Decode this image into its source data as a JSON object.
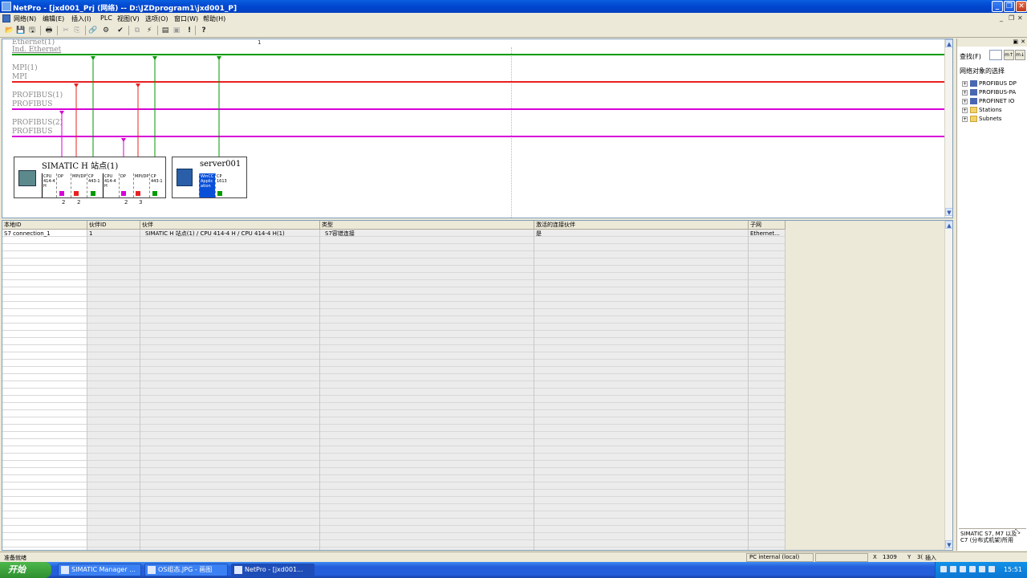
{
  "window": {
    "title": "NetPro - [jxd001_Prj (网络) -- D:\\JZDprogram1\\jxd001_P]",
    "minimize": "_",
    "maximize": "❐",
    "close": "✕"
  },
  "menu": {
    "items": [
      "网络(N)",
      "编辑(E)",
      "插入(I)",
      "PLC",
      "视图(V)",
      "选项(O)",
      "窗口(W)",
      "帮助(H)"
    ],
    "mdi_minimize": "_",
    "mdi_restore": "❐",
    "mdi_close": "✕"
  },
  "toolbar": {
    "buttons": [
      "📂",
      "💾",
      "🖫",
      "🖶",
      "✂",
      "⎘",
      "⧉",
      "🔗",
      "⚙",
      "✔",
      "⚡",
      "▤",
      "▣",
      "!",
      "?"
    ],
    "icons": [
      "open-icon",
      "save-icon",
      "save-compile-icon",
      "print-icon",
      "cut-icon",
      "copy-icon",
      "paste-icon",
      "download-icon",
      "upload-icon",
      "check-icon",
      "connect-icon",
      "catalog-icon",
      "view-icon",
      "alert-icon",
      "help-icon"
    ]
  },
  "network": {
    "ruler_label": "1",
    "subnets": [
      {
        "name": "Ethernet(1)",
        "type": "Ind. Ethernet",
        "color": "#009a00"
      },
      {
        "name": "MPI(1)",
        "type": "MPI",
        "color": "#e82020"
      },
      {
        "name": "PROFIBUS(1)",
        "type": "PROFIBUS",
        "color": "#d800d8"
      },
      {
        "name": "PROFIBUS(2)",
        "type": "PROFIBUS",
        "color": "#d800d8"
      }
    ],
    "station_h": {
      "title": "SIMATIC H 站点(1)",
      "slots": [
        "CPU\n414-4\nH",
        "DP",
        "MPI/DP",
        "CP\n443-1",
        "CPU\n414-4\nH",
        "DP",
        "MPI/DP",
        "CP\n443-1"
      ],
      "port_numbers": [
        "2",
        "2",
        "2",
        "3"
      ]
    },
    "station_pc": {
      "title": "server001",
      "slots": [
        "WinCC\nApplic\nation",
        "CP\n1613"
      ]
    }
  },
  "table": {
    "headers": [
      "本地ID",
      "伙伴ID",
      "伙伴",
      "类型",
      "激活的连接伙伴",
      "子网"
    ],
    "rows": [
      [
        "S7 connection_1",
        "1",
        "SIMATIC H 站点(1) / CPU 414-4 H / CPU 414-4 H(1)",
        "S7容错连接",
        "是",
        "Ethernet..."
      ]
    ]
  },
  "sidepanel": {
    "find_label": "查找(F)",
    "find_next": "m↑",
    "find_prev": "m↓",
    "selection_label": "网络对象的选择",
    "tree": [
      "PROFIBUS DP",
      "PROFIBUS-PA",
      "PROFINET IO",
      "Stations",
      "Subnets"
    ],
    "info_text": "SIMATIC S7, M7 以及 C7 (分布式机架)所用"
  },
  "status": {
    "ready": "准备就绪",
    "interface": "PC internal (local)",
    "x_label": "X",
    "x_value": "1309",
    "y_label": "Y",
    "y_value": "3(",
    "mode": "插入"
  },
  "taskbar": {
    "start": "开始",
    "tasks": [
      "SIMATIC Manager ...",
      "OS组态.JPG - 画图",
      "NetPro - [jxd001..."
    ],
    "clock": "15:51"
  }
}
